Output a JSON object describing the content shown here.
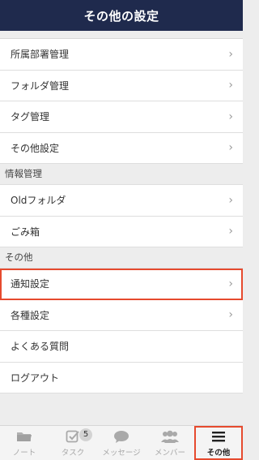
{
  "header": {
    "title": "その他の設定"
  },
  "group1": {
    "items": [
      {
        "label": "所属部署管理"
      },
      {
        "label": "フォルダ管理"
      },
      {
        "label": "タグ管理"
      },
      {
        "label": "その他設定"
      }
    ]
  },
  "info_section": {
    "title": "情報管理",
    "items": [
      {
        "label": "Oldフォルダ"
      },
      {
        "label": "ごみ箱"
      }
    ]
  },
  "other_section": {
    "title": "その他",
    "items": [
      {
        "label": "通知設定"
      },
      {
        "label": "各種設定"
      },
      {
        "label": "よくある質問"
      },
      {
        "label": "ログアウト"
      }
    ]
  },
  "chevron": "›",
  "tabbar": {
    "tabs": [
      {
        "label": "ノート",
        "icon": "folder-icon"
      },
      {
        "label": "タスク",
        "icon": "checkbox-icon",
        "badge": "5"
      },
      {
        "label": "メッセージ",
        "icon": "chat-bubble-icon"
      },
      {
        "label": "メンバー",
        "icon": "members-icon"
      },
      {
        "label": "その他",
        "icon": "menu-icon"
      }
    ]
  },
  "colors": {
    "header_bg": "#1f2a4d",
    "highlight": "#e64a2e",
    "tab_inactive": "#a9a9a9"
  }
}
